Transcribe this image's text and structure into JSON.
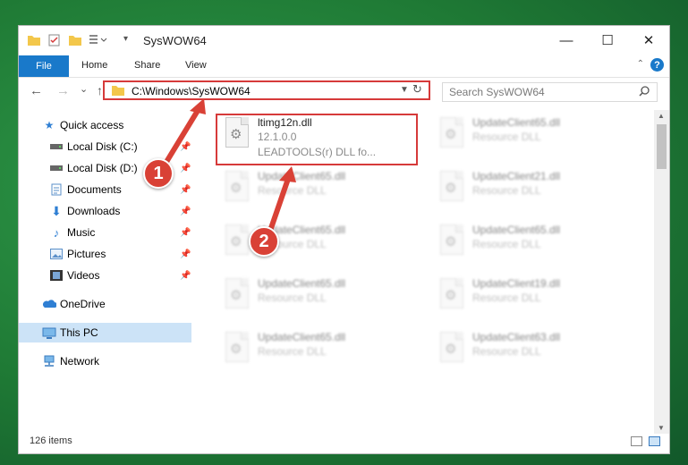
{
  "window": {
    "title": "SysWOW64",
    "minimize": "—",
    "maximize": "☐",
    "close": "✕"
  },
  "ribbon": {
    "file": "File",
    "tabs": [
      "Home",
      "Share",
      "View"
    ],
    "help": "?"
  },
  "nav": {
    "back": "←",
    "forward": "→",
    "recent": "⌄",
    "up": "↑",
    "address": "C:\\Windows\\SysWOW64",
    "refresh": "↻",
    "search_placeholder": "Search SysWOW64"
  },
  "sidebar": {
    "items": [
      {
        "label": "Quick access",
        "icon": "star-icon"
      },
      {
        "label": "Local Disk (C:)",
        "icon": "drive-icon"
      },
      {
        "label": "Local Disk (D:)",
        "icon": "drive-icon"
      },
      {
        "label": "Documents",
        "icon": "documents-icon"
      },
      {
        "label": "Downloads",
        "icon": "download-icon"
      },
      {
        "label": "Music",
        "icon": "music-icon"
      },
      {
        "label": "Pictures",
        "icon": "pictures-icon"
      },
      {
        "label": "Videos",
        "icon": "videos-icon"
      },
      {
        "label": "OneDrive",
        "icon": "cloud-icon"
      },
      {
        "label": "This PC",
        "icon": "computer-icon"
      },
      {
        "label": "Network",
        "icon": "network-icon"
      }
    ]
  },
  "files": {
    "highlighted": {
      "name": "ltimg12n.dll",
      "version": "12.1.0.0",
      "desc": "LEADTOOLS(r) DLL fo..."
    },
    "blurred": [
      {
        "name": "UpdateClient65.dll",
        "desc": "Resource DLL"
      },
      {
        "name": "UpdateClient65.dll",
        "desc": "Resource DLL"
      },
      {
        "name": "UpdateClient21.dll",
        "desc": "Resource DLL"
      },
      {
        "name": "UpdateClient65.dll",
        "desc": "Resource DLL"
      },
      {
        "name": "UpdateClient65.dll",
        "desc": "Resource DLL"
      },
      {
        "name": "UpdateClient65.dll",
        "desc": "Resource DLL"
      },
      {
        "name": "UpdateClient19.dll",
        "desc": "Resource DLL"
      },
      {
        "name": "UpdateClient65.dll",
        "desc": "Resource DLL"
      },
      {
        "name": "UpdateClient63.dll",
        "desc": "Resource DLL"
      }
    ]
  },
  "status": {
    "count": "126 items"
  },
  "annotations": {
    "step1": "1",
    "step2": "2",
    "color": "#d94136"
  }
}
